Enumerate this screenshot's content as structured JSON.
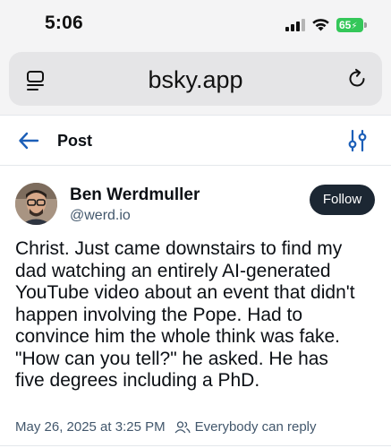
{
  "status_bar": {
    "time": "5:06",
    "battery": "65"
  },
  "browser": {
    "url": "bsky.app"
  },
  "header": {
    "title": "Post"
  },
  "post": {
    "author_name": "Ben Werdmuller",
    "author_handle": "@werd.io",
    "follow_label": "Follow",
    "text": "Christ. Just came downstairs to find my\ndad watching an entirely AI-generated\nYouTube video about an event that didn't\nhappen involving the Pope. Had to\nconvince him the whole think was fake.\n\"How can you tell?\" he asked. He has\nfive degrees including a PhD.",
    "timestamp": "May 26, 2025 at 3:25 PM",
    "reply_setting": "Everybody can reply"
  }
}
